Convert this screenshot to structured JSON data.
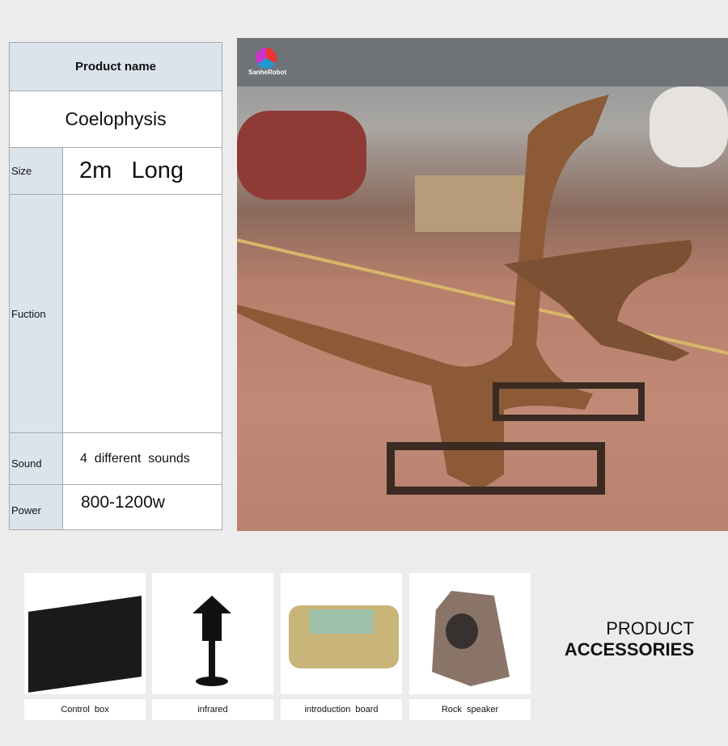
{
  "spec_table": {
    "header": "Product  name",
    "product_name": "Coelophysis",
    "rows": [
      {
        "label": "Size",
        "value": "2m   Long"
      },
      {
        "label": "Fuction",
        "value": ""
      },
      {
        "label": "Sound",
        "value": "4  different  sounds"
      },
      {
        "label": "Power",
        "value": "800-1200w"
      }
    ]
  },
  "photo": {
    "logo_text": "SanheRobot"
  },
  "accessories": {
    "title_line1": "PRODUCT",
    "title_line2": "ACCESSORIES",
    "items": [
      {
        "label": "Control  box"
      },
      {
        "label": "infrared"
      },
      {
        "label": "introduction  board"
      },
      {
        "label": "Rock  speaker"
      }
    ]
  }
}
